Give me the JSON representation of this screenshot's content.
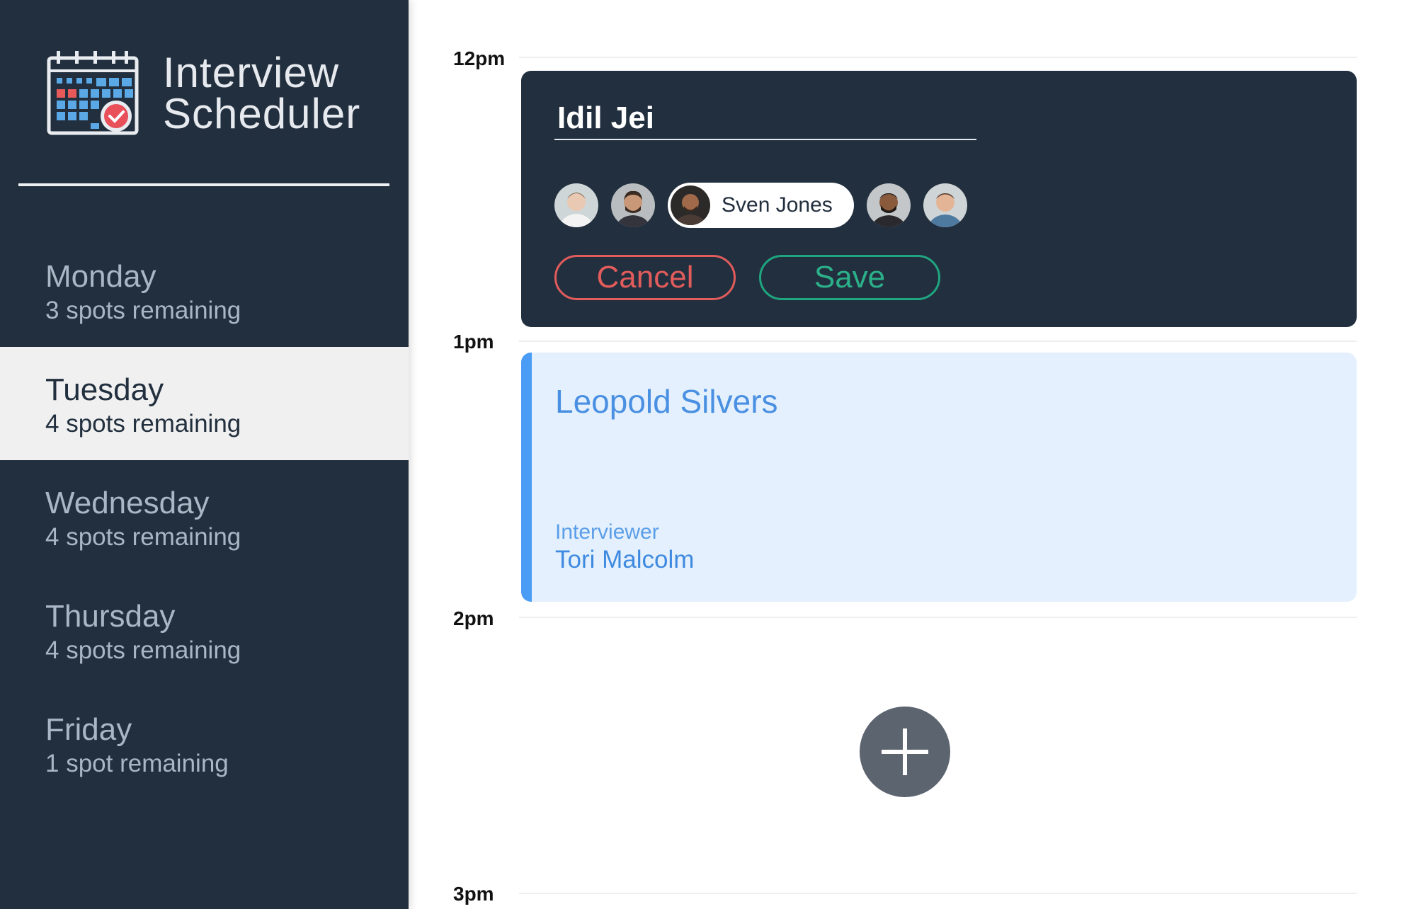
{
  "app": {
    "title_line1": "Interview",
    "title_line2": "Scheduler"
  },
  "days": [
    {
      "name": "Monday",
      "spots": "3 spots remaining",
      "selected": false
    },
    {
      "name": "Tuesday",
      "spots": "4 spots remaining",
      "selected": true
    },
    {
      "name": "Wednesday",
      "spots": "4 spots remaining",
      "selected": false
    },
    {
      "name": "Thursday",
      "spots": "4 spots remaining",
      "selected": false
    },
    {
      "name": "Friday",
      "spots": "1 spot remaining",
      "selected": false
    }
  ],
  "schedule": {
    "times": [
      "12pm",
      "1pm",
      "2pm",
      "3pm"
    ],
    "form": {
      "student_name": "Idil Jei",
      "selected_interviewer": "Sven Jones",
      "cancel_label": "Cancel",
      "save_label": "Save"
    },
    "appointment": {
      "student": "Leopold Silvers",
      "interviewer_label": "Interviewer",
      "interviewer_name": "Tori Malcolm"
    }
  },
  "colors": {
    "sidebar": "#222f3e",
    "selected_day_bg": "#f0f0f0",
    "cancel": "#e25c5c",
    "save": "#1fa57f",
    "appointment_accent": "#4a9cf5",
    "add_button": "#5c6470"
  },
  "icons": {
    "logo": "calendar-check-icon",
    "add": "plus-icon"
  }
}
